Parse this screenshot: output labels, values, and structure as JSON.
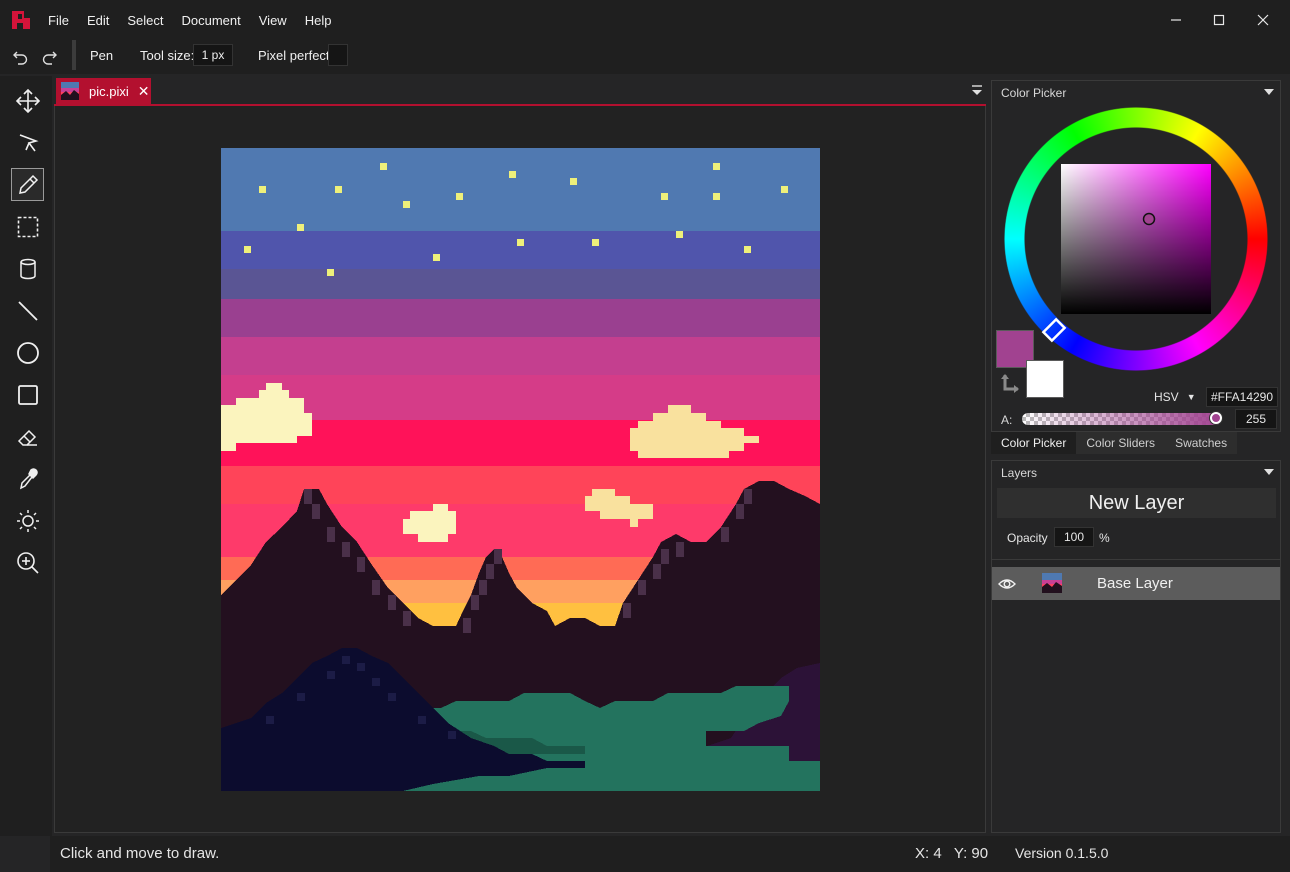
{
  "app": {
    "name": "Pixi"
  },
  "menu": {
    "items": [
      "File",
      "Edit",
      "Select",
      "Document",
      "View",
      "Help"
    ]
  },
  "toolbar": {
    "tool_name": "Pen",
    "tool_size_label": "Tool size:",
    "tool_size_value": "1 px",
    "pixel_perfect_label": "Pixel perfect",
    "pixel_perfect_enabled": false
  },
  "tools": [
    {
      "name": "move",
      "icon": "move-icon"
    },
    {
      "name": "pointer",
      "icon": "pointer-icon"
    },
    {
      "name": "pen",
      "icon": "pen-icon",
      "active": true
    },
    {
      "name": "selection",
      "icon": "selection-icon"
    },
    {
      "name": "bucket",
      "icon": "bucket-icon"
    },
    {
      "name": "line",
      "icon": "line-icon"
    },
    {
      "name": "ellipse",
      "icon": "ellipse-icon"
    },
    {
      "name": "rectangle",
      "icon": "rectangle-icon"
    },
    {
      "name": "eraser",
      "icon": "eraser-icon"
    },
    {
      "name": "eyedropper",
      "icon": "eyedropper-icon"
    },
    {
      "name": "brightness",
      "icon": "brightness-icon"
    },
    {
      "name": "zoom",
      "icon": "zoom-icon"
    }
  ],
  "document": {
    "tab_title": "pic.pixi",
    "tab_close": "✕"
  },
  "color_picker": {
    "title": "Color Picker",
    "mode": "HSV",
    "hex": "#FFA14290",
    "alpha_label": "A:",
    "alpha_value": "255",
    "alpha_fraction": 1.0,
    "primary_color": "#a14290",
    "secondary_color": "#ffffff",
    "tabs": [
      "Color Picker",
      "Color Sliders",
      "Swatches"
    ],
    "active_tab": "Color Picker"
  },
  "layers": {
    "title": "Layers",
    "new_layer_label": "New Layer",
    "opacity_label": "Opacity",
    "opacity_value": "100",
    "opacity_unit": "%",
    "items": [
      {
        "name": "Base Layer",
        "visible": true
      }
    ]
  },
  "status": {
    "message": "Click and move to draw.",
    "cursor": "X: 4   Y: 90",
    "version": "Version 0.1.5.0"
  },
  "colors": {
    "accent": "#b3102f",
    "panel_bg": "#252526",
    "chrome_bg": "#1f1f1f"
  }
}
